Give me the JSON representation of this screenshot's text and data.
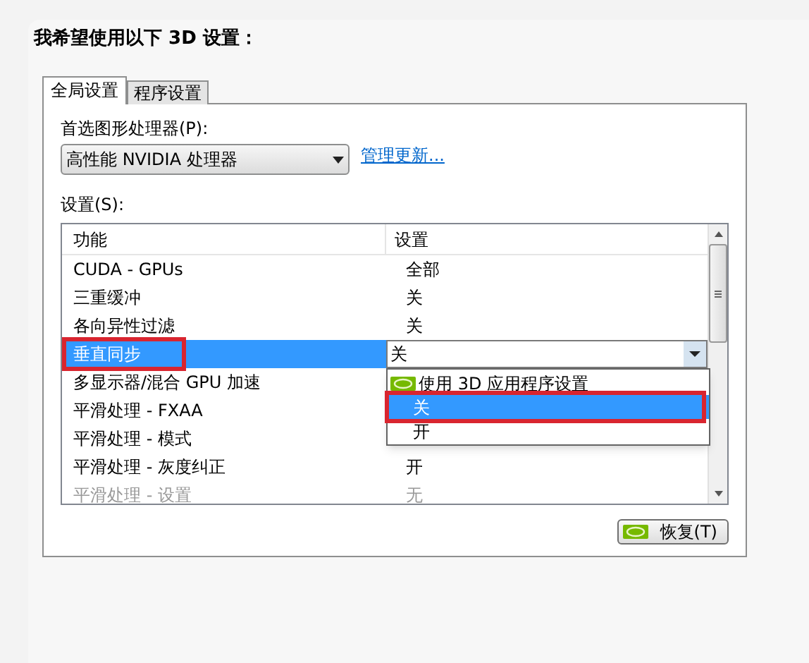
{
  "heading": "我希望使用以下 3D 设置：",
  "tabs": [
    {
      "label": "全局设置",
      "selected": true
    },
    {
      "label": "程序设置",
      "selected": false
    }
  ],
  "gpu": {
    "label": "首选图形处理器(P):",
    "value": "高性能 NVIDIA 处理器",
    "link": "管理更新..."
  },
  "settings": {
    "label": "设置(S):",
    "columns": [
      "功能",
      "设置"
    ],
    "rows": [
      {
        "feature": "CUDA - GPUs",
        "setting": "全部",
        "selected": false,
        "dimmed": false,
        "annotated": false
      },
      {
        "feature": "三重缓冲",
        "setting": "关",
        "selected": false,
        "dimmed": false,
        "annotated": false
      },
      {
        "feature": "各向异性过滤",
        "setting": "关",
        "selected": false,
        "dimmed": false,
        "annotated": false
      },
      {
        "feature": "垂直同步",
        "setting": "关",
        "selected": true,
        "dimmed": false,
        "annotated": true
      },
      {
        "feature": "多显示器/混合 GPU 加速",
        "selected": false,
        "dimmed": false,
        "annotated": false
      },
      {
        "feature": "平滑处理 - FXAA",
        "selected": false,
        "dimmed": false,
        "annotated": false
      },
      {
        "feature": "平滑处理 - 模式",
        "selected": false,
        "dimmed": false,
        "annotated": false
      },
      {
        "feature": "平滑处理 - 灰度纠正",
        "setting": "开",
        "selected": false,
        "dimmed": false,
        "annotated": false
      },
      {
        "feature": "平滑处理 - 设置",
        "setting": "无",
        "selected": false,
        "dimmed": true,
        "annotated": false
      }
    ],
    "dropdown_options": [
      {
        "label": "使用 3D 应用程序设置",
        "kind": "app",
        "selected": false,
        "annotated": false
      },
      {
        "label": "关",
        "kind": "plain",
        "selected": true,
        "annotated": true
      },
      {
        "label": "开",
        "kind": "plain",
        "selected": false,
        "annotated": false
      }
    ]
  },
  "restore_button": "恢复(T)"
}
